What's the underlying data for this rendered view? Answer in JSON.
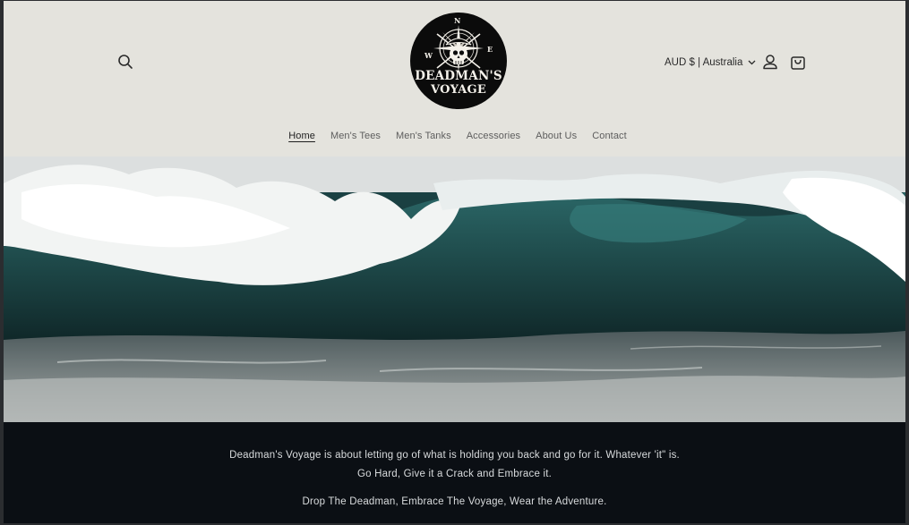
{
  "header": {
    "logo": {
      "line1": "DEADMAN'S",
      "line2": "VOYAGE",
      "compass": {
        "n": "N",
        "w": "W",
        "e": "E"
      }
    },
    "currency_label": "AUD $ | Australia",
    "icons": {
      "search": "search-icon",
      "account": "account-icon",
      "cart": "cart-icon",
      "chevron": "chevron-down-icon"
    }
  },
  "nav": {
    "items": [
      {
        "label": "Home",
        "active": true
      },
      {
        "label": "Men's Tees",
        "active": false
      },
      {
        "label": "Men's Tanks",
        "active": false
      },
      {
        "label": "Accessories",
        "active": false
      },
      {
        "label": "About Us",
        "active": false
      },
      {
        "label": "Contact",
        "active": false
      }
    ]
  },
  "banner": {
    "line1": "Deadman's Voyage is about letting go of what is holding you back and go for it. Whatever 'it\" is.",
    "line2": "Go Hard, Give it a Crack and Embrace it.",
    "line3": "Drop The Deadman, Embrace The Voyage, Wear the Adventure."
  },
  "colors": {
    "header_bg": "#e4e3dd",
    "banner_bg": "#0b0f14",
    "logo_bg": "#0b0b0b",
    "wave_teal": "#1d4a4c"
  }
}
